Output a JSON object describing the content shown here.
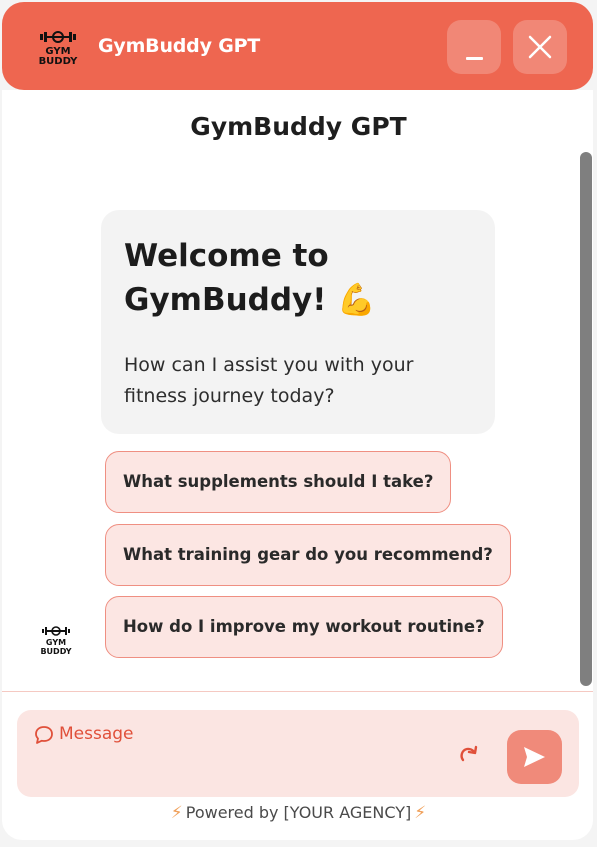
{
  "header": {
    "title": "GymBuddy GPT",
    "logo_text_1": "GYM",
    "logo_text_2": "BUDDY",
    "minimize_icon": "minimize-icon",
    "close_icon": "close-icon",
    "accent": "#ee6650"
  },
  "chat": {
    "title": "GymBuddy GPT",
    "welcome_heading": "Welcome to GymBuddy!",
    "welcome_emoji": "💪",
    "welcome_body": "How can I assist you with your fitness journey today?",
    "suggestions": [
      "What supplements should I take?",
      "What training gear do you recommend?",
      "How do I improve my workout routine?"
    ],
    "avatar_text_1": "GYM",
    "avatar_text_2": "BUDDY"
  },
  "composer": {
    "placeholder": "Message",
    "message_icon": "message-icon",
    "redo_icon": "redo-icon",
    "send_icon": "send-icon",
    "send_color": "#f08a7a"
  },
  "footer": {
    "text": "Powered by [YOUR AGENCY]",
    "bolt": "⚡"
  }
}
